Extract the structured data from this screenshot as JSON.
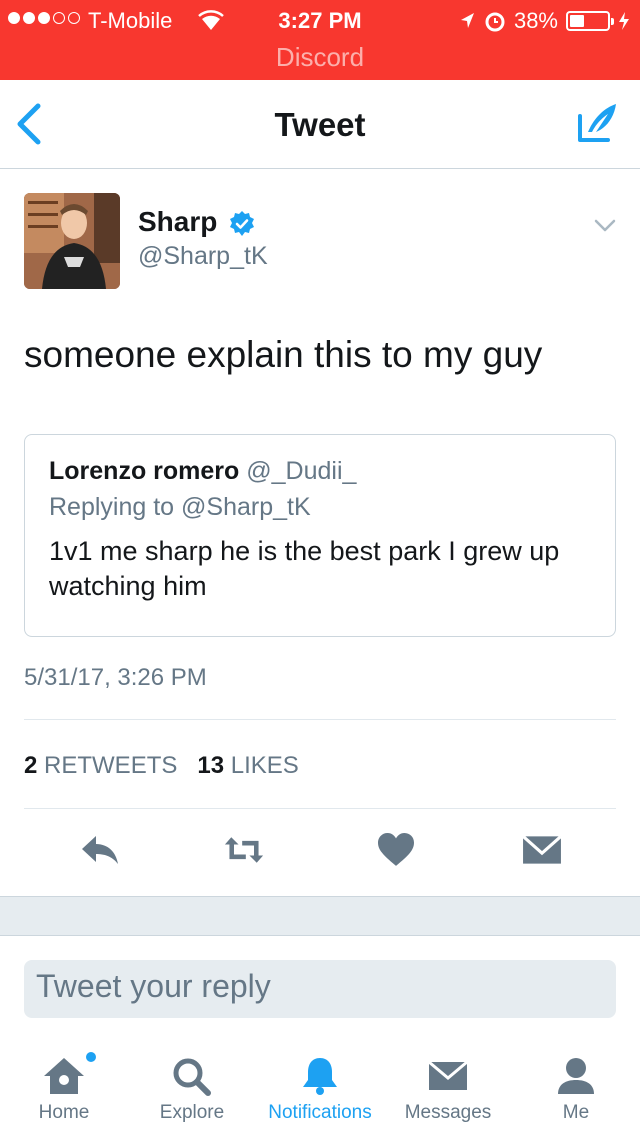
{
  "status_bar": {
    "carrier": "T-Mobile",
    "time": "3:27 PM",
    "battery_percent": "38%",
    "battery_level": 0.38,
    "return_app": "Discord"
  },
  "nav": {
    "title": "Tweet"
  },
  "tweet": {
    "author_name": "Sharp",
    "author_handle": "@Sharp_tK",
    "text": "someone explain this to my guy",
    "timestamp": "5/31/17, 3:26 PM",
    "retweets_count": "2",
    "retweets_label": "RETWEETS",
    "likes_count": "13",
    "likes_label": "LIKES"
  },
  "quoted": {
    "name": "Lorenzo romero",
    "handle": "@_Dudii_",
    "replying_to": "Replying to @Sharp_tK",
    "text": "1v1 me sharp he is the best park I grew up watching him"
  },
  "reply": {
    "placeholder": "Tweet your reply"
  },
  "tabs": [
    {
      "label": "Home",
      "icon": "home-icon"
    },
    {
      "label": "Explore",
      "icon": "search-icon"
    },
    {
      "label": "Notifications",
      "icon": "bell-icon"
    },
    {
      "label": "Messages",
      "icon": "envelope-icon"
    },
    {
      "label": "Me",
      "icon": "person-icon"
    }
  ],
  "colors": {
    "status_bar": "#f8372f",
    "accent": "#1da1f2",
    "secondary_text": "#657786",
    "icon_gray": "#657786"
  }
}
